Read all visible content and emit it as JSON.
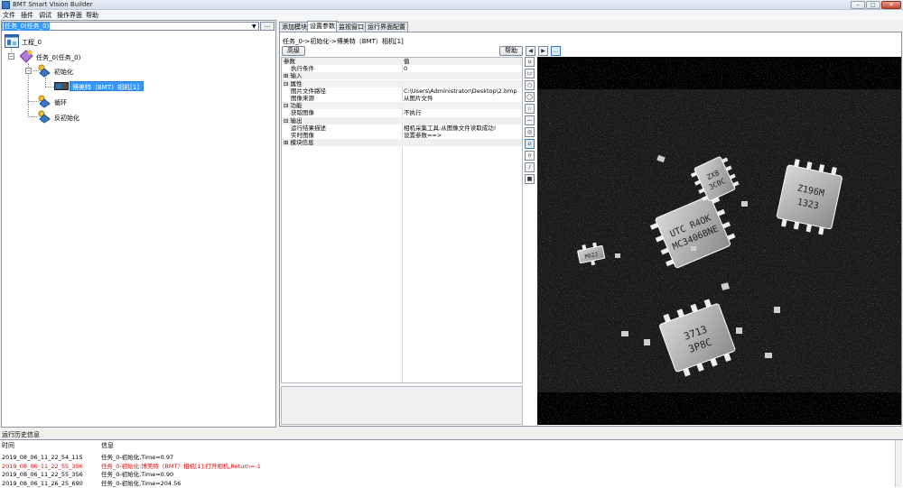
{
  "window": {
    "title": "BMT Smart Vision Builder",
    "min": "–",
    "max": "□",
    "close": "✕"
  },
  "menu": [
    "文件",
    "插件",
    "调试",
    "操作界面",
    "帮助"
  ],
  "task_selector": {
    "value": "任务_0(任务_0)",
    "more": "..."
  },
  "tree": {
    "project": "工程_0",
    "task": "任务_0(任务_0)",
    "init": "初始化",
    "camera": "博美特（BMT）相机[1]",
    "loop": "循环",
    "deinit": "反初始化"
  },
  "tabs": [
    "添加模块",
    "设置参数",
    "监视窗口",
    "运行界面配置"
  ],
  "breadcrumb": "任务_0->初始化->博美特（BMT）相机[1]",
  "buttons": {
    "advanced": "高级",
    "help": "帮助",
    "more": "..."
  },
  "grid": {
    "header": {
      "param": "参数",
      "value": "值"
    },
    "rows": [
      {
        "name": "执行条件",
        "value": "0",
        "cat": false
      },
      {
        "name": "⊞  输入",
        "value": "",
        "cat": true
      },
      {
        "name": "⊟  属性",
        "value": "",
        "cat": true
      },
      {
        "name": "图片文件路径",
        "value": "C:\\Users\\Administrator\\Desktop\\2.bmp",
        "cat": false
      },
      {
        "name": "图像来源",
        "value": "从图片文件",
        "cat": false
      },
      {
        "name": "⊟  功能",
        "value": "",
        "cat": true
      },
      {
        "name": "获取图像",
        "value": "不执行",
        "cat": false
      },
      {
        "name": "⊟  输出",
        "value": "",
        "cat": true
      },
      {
        "name": "运行结果描述",
        "value": "相机采集工具:从图像文件读取成功!",
        "cat": false
      },
      {
        "name": "实时图像",
        "value": "设置参数==>",
        "cat": false
      },
      {
        "name": "⊞  模块信息",
        "value": "",
        "cat": true
      }
    ]
  },
  "log": {
    "title": "运行历史信息",
    "col_time": "时间",
    "col_msg": "信息",
    "rows": [
      {
        "time": "2019_08_06_11_22_54_115",
        "msg": "任务_0-初始化,Time=0.97",
        "error": false
      },
      {
        "time": "2019_08_06_11_22_55_356",
        "msg": "任务_0-初始化:博美特（BMT）相机[1]:打开相机,Return=-1",
        "error": true
      },
      {
        "time": "2019_08_06_11_22_55_356",
        "msg": "任务_0-初始化,Time=0.90",
        "error": false
      },
      {
        "time": "2019_08_06_11_26_25_690",
        "msg": "任务_0-初始化,Time=204.56",
        "error": false
      }
    ]
  },
  "chips": [
    {
      "text": "UTC R4OK MC3406BNE"
    },
    {
      "text": "ZX8 3C0C"
    },
    {
      "text": "Z196M 1323"
    },
    {
      "text": "3713 3P8C"
    },
    {
      "text": "M6ZJ"
    }
  ]
}
